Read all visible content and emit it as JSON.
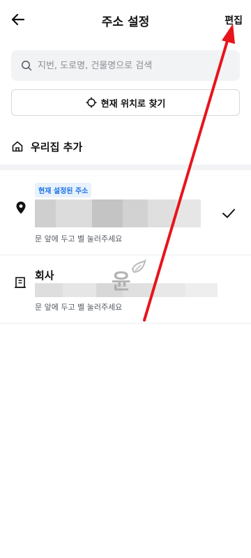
{
  "header": {
    "title": "주소 설정",
    "edit_label": "편집"
  },
  "search": {
    "placeholder": "지번, 도로명, 건물명으로 검색",
    "value": ""
  },
  "locate_button": {
    "label": "현재 위치로 찾기"
  },
  "add_home": {
    "label": "우리집 추가"
  },
  "addresses": [
    {
      "badge": "현재 설정된 주소",
      "name": "",
      "note": "문 앞에 두고 벨 눌러주세요",
      "selected": true
    },
    {
      "badge": "",
      "name": "회사",
      "note": "문 앞에 두고 벨 눌러주세요",
      "selected": false
    }
  ],
  "colors": {
    "accent": "#1a73e8",
    "annotation": "#e8141c"
  }
}
